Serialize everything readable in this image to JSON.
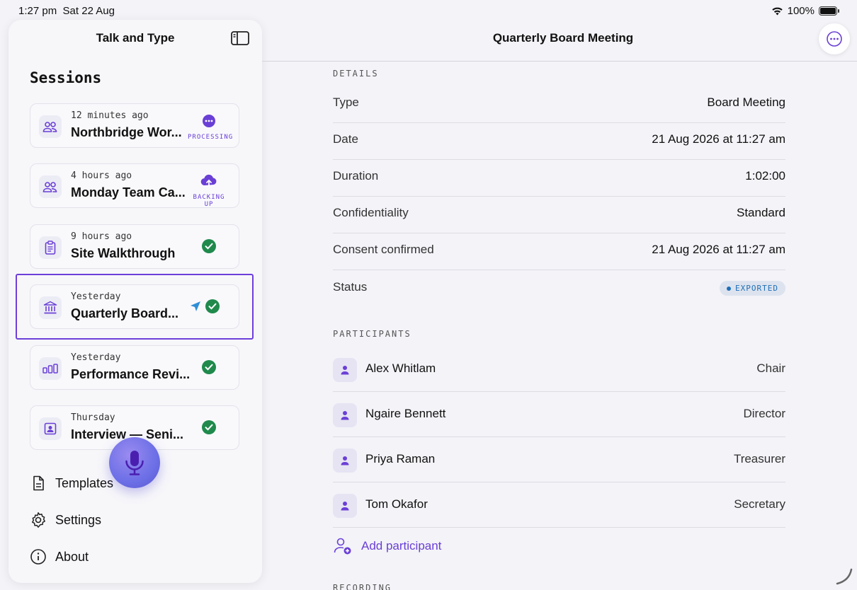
{
  "statusbar": {
    "time": "1:27 pm",
    "date": "Sat 22 Aug",
    "battery": "100%"
  },
  "sidebar": {
    "title": "Talk and Type",
    "sessions_heading": "Sessions",
    "sessions": [
      {
        "time": "12 minutes ago",
        "name": "Northbridge Wor...",
        "status": "PROCESSING",
        "icon": "people-icon"
      },
      {
        "time": "4 hours ago",
        "name": "Monday Team Ca...",
        "status": "BACKING UP",
        "icon": "people-icon"
      },
      {
        "time": "9 hours ago",
        "name": "Site Walkthrough",
        "status": "done",
        "icon": "clipboard-icon"
      },
      {
        "time": "Yesterday",
        "name": "Quarterly Board...",
        "status": "done",
        "icon": "bank-icon"
      },
      {
        "time": "Yesterday",
        "name": "Performance Revi...",
        "status": "done",
        "icon": "bar-chart-icon"
      },
      {
        "time": "Thursday",
        "name": "Interview — Seni...",
        "status": "done",
        "icon": "id-badge-icon"
      }
    ],
    "nav": {
      "templates": "Templates",
      "settings": "Settings",
      "about": "About"
    }
  },
  "main": {
    "title": "Quarterly Board Meeting",
    "details_heading": "DETAILS",
    "details": [
      {
        "key": "Type",
        "value": "Board Meeting"
      },
      {
        "key": "Date",
        "value": "21 Aug 2026 at 11:27 am"
      },
      {
        "key": "Duration",
        "value": "1:02:00"
      },
      {
        "key": "Confidentiality",
        "value": "Standard"
      },
      {
        "key": "Consent confirmed",
        "value": "21 Aug 2026 at 11:27 am"
      }
    ],
    "status_label": "Status",
    "status_value": "EXPORTED",
    "participants_heading": "PARTICIPANTS",
    "participants": [
      {
        "name": "Alex Whitlam",
        "role": "Chair"
      },
      {
        "name": "Ngaire Bennett",
        "role": "Director"
      },
      {
        "name": "Priya Raman",
        "role": "Treasurer"
      },
      {
        "name": "Tom Okafor",
        "role": "Secretary"
      }
    ],
    "add_participant": "Add participant",
    "recording_heading": "RECORDING"
  },
  "colors": {
    "accent": "#6a3fd6",
    "success": "#1f8a4c",
    "exported": "#1e6fb8"
  }
}
